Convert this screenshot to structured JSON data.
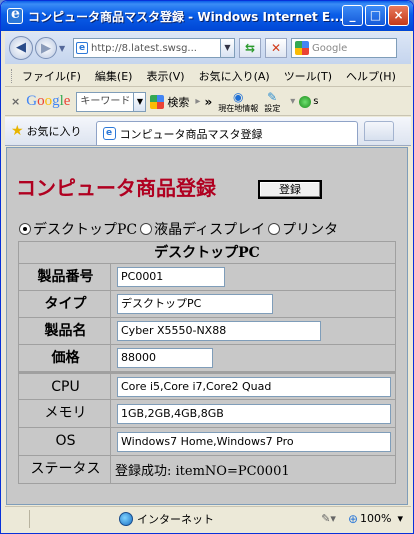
{
  "window": {
    "title": "コンピュータ商品マスタ登録 - Windows Internet E..."
  },
  "address_bar": {
    "url": "http://8.latest.swsg...",
    "search_placeholder": "Google"
  },
  "menu": {
    "items": [
      "ファイル(F)",
      "編集(E)",
      "表示(V)",
      "お気に入り(A)",
      "ツール(T)",
      "ヘルプ(H)"
    ]
  },
  "google_toolbar": {
    "close": "×",
    "keyword_placeholder": "キーワード",
    "search_label": "検索",
    "more": "»",
    "location_label": "現在地情報",
    "settings_label": "設定",
    "s_label": "s"
  },
  "tabs": {
    "favorites_label": "お気に入り",
    "active_tab": "コンピュータ商品マスタ登録"
  },
  "page": {
    "heading": "コンピュータ商品登録",
    "register_button": "登録",
    "radio_options": [
      {
        "label": "デスクトップPC",
        "checked": true
      },
      {
        "label": "液晶ディスプレイ",
        "checked": false
      },
      {
        "label": "プリンタ",
        "checked": false
      }
    ],
    "table_title": "デスクトップPC",
    "fields": {
      "product_no": {
        "label": "製品番号",
        "value": "PC0001"
      },
      "type": {
        "label": "タイプ",
        "value": "デスクトップPC"
      },
      "product_name": {
        "label": "製品名",
        "value": "Cyber X5550-NX88"
      },
      "price": {
        "label": "価格",
        "value": "88000"
      },
      "cpu": {
        "label": "CPU",
        "value": "Core i5,Core i7,Core2 Quad"
      },
      "memory": {
        "label": "メモリ",
        "value": "1GB,2GB,4GB,8GB"
      },
      "os": {
        "label": "OS",
        "value": "Windows7 Home,Windows7 Pro"
      },
      "status": {
        "label": "ステータス",
        "value": "登録成功: itemNO=PC0001"
      }
    }
  },
  "statusbar": {
    "zone": "インターネット",
    "zoom": "100%"
  }
}
